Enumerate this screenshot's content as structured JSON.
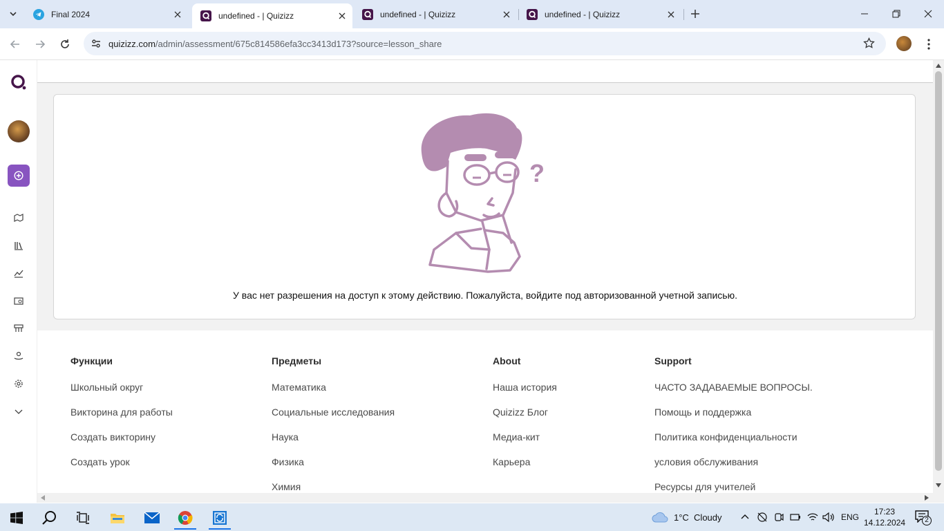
{
  "browser": {
    "tabs": [
      {
        "title": "Final 2024",
        "icon": "telegram-icon",
        "active": false
      },
      {
        "title": "undefined - | Quizizz",
        "icon": "quizizz-icon",
        "active": true
      },
      {
        "title": "undefined - | Quizizz",
        "icon": "quizizz-icon",
        "active": false
      },
      {
        "title": "undefined - | Quizizz",
        "icon": "quizizz-icon",
        "active": false
      }
    ],
    "url_host": "quizizz.com",
    "url_path": "/admin/assessment/675c814586efa3cc3413d173?source=lesson_share"
  },
  "sidebar": {
    "items": [
      "explore-icon",
      "library-icon",
      "reports-icon",
      "classes-icon",
      "accommodations-icon",
      "quizizz-ai-icon",
      "settings-icon",
      "more-chevron-icon"
    ]
  },
  "main": {
    "message": "У вас нет разрешения на доступ к этому действию. Пожалуйста, войдите под авторизованной учетной записью."
  },
  "footer": {
    "columns": [
      {
        "heading": "Функции",
        "links": [
          "Школьный округ",
          "Викторина для работы",
          "Создать викторину",
          "Создать урок"
        ]
      },
      {
        "heading": "Предметы",
        "links": [
          "Математика",
          "Социальные исследования",
          "Наука",
          "Физика",
          "Химия"
        ]
      },
      {
        "heading": "About",
        "links": [
          "Наша история",
          "Quizizz Блог",
          "Медиа-кит",
          "Карьера"
        ]
      },
      {
        "heading": "Support",
        "links": [
          "ЧАСТО ЗАДАВАЕМЫЕ ВОПРОСЫ.",
          "Помощь и поддержка",
          "Политика конфиденциальности",
          "условия обслуживания",
          "Ресурсы для учителей"
        ]
      }
    ]
  },
  "taskbar": {
    "weather": "1°C  Cloudy",
    "lang": "ENG",
    "time": "17:23",
    "date": "14.12.2024",
    "notifications": "2"
  },
  "colors": {
    "accent": "#8854c0",
    "illustration": "#b48cb0"
  }
}
